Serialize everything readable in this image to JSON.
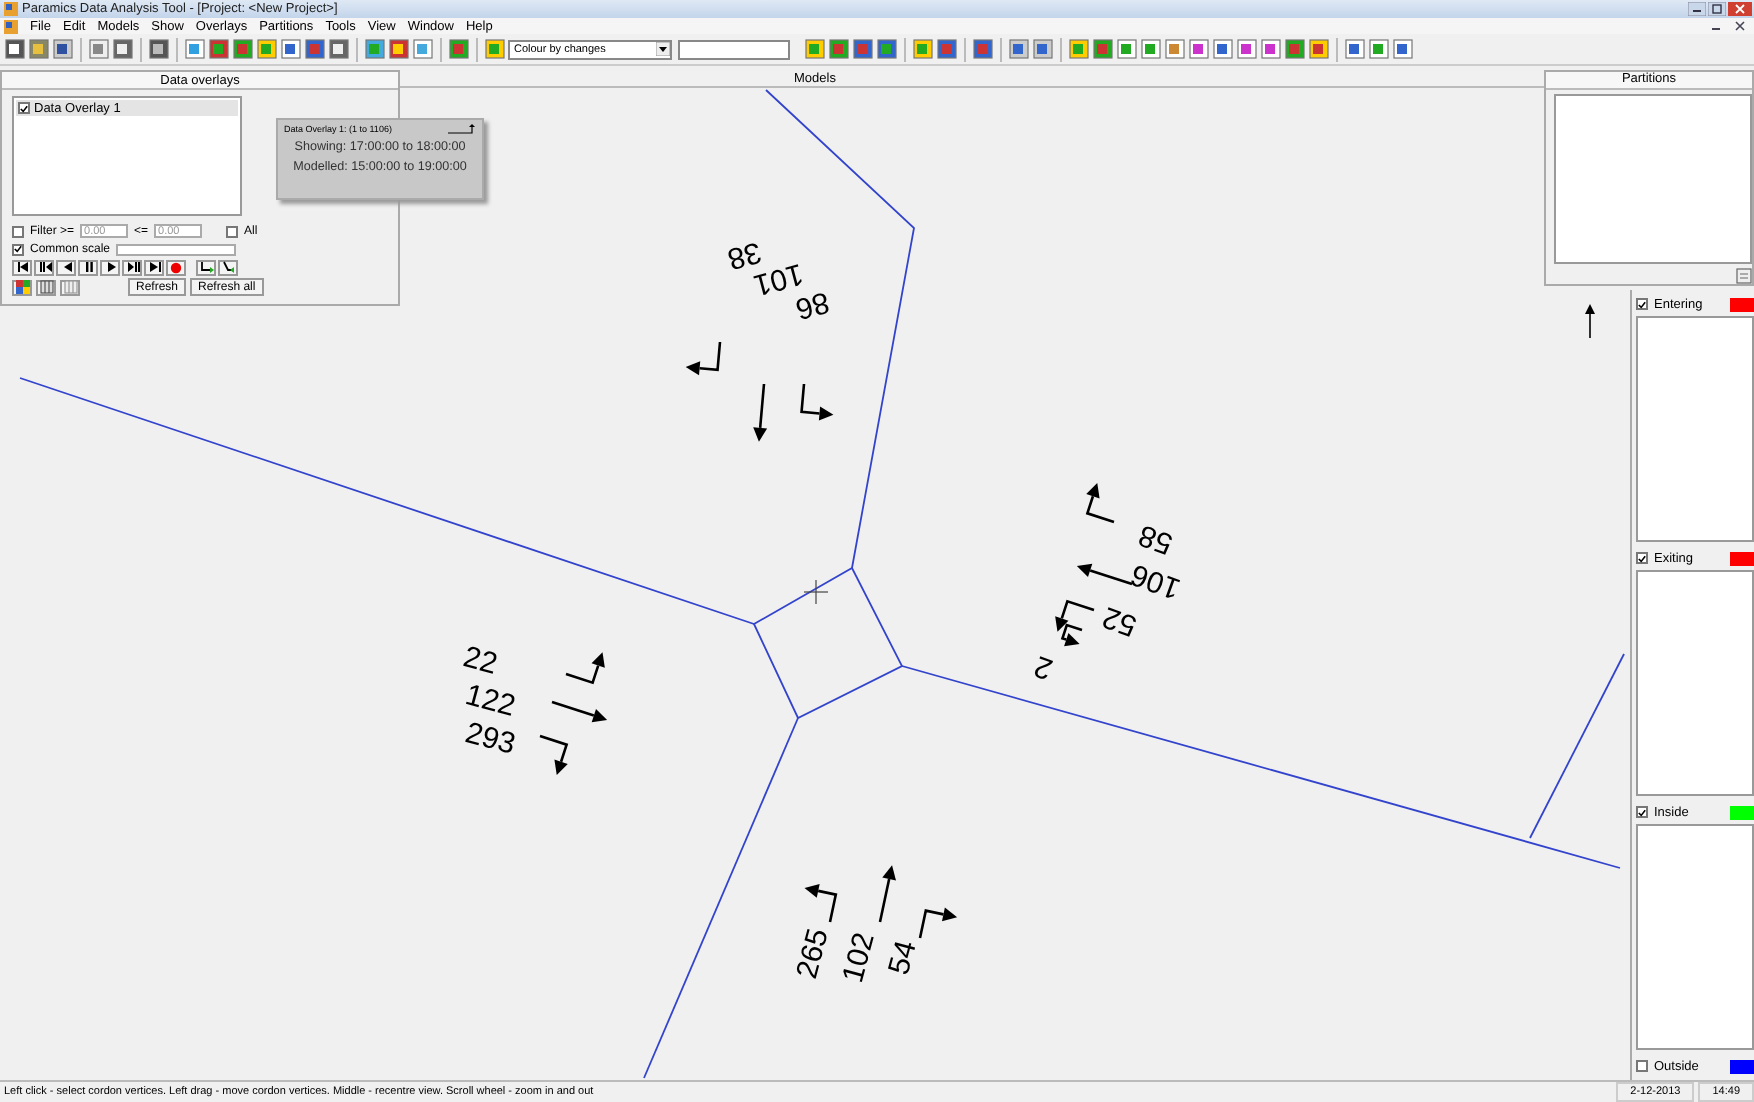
{
  "window": {
    "title": "Paramics Data Analysis Tool - [Project: <New Project>]"
  },
  "menu": [
    "File",
    "Edit",
    "Models",
    "Show",
    "Overlays",
    "Partitions",
    "Tools",
    "View",
    "Window",
    "Help"
  ],
  "toolbar": {
    "colour_mode": "Colour by changes"
  },
  "headers": {
    "data_overlays": "Data overlays",
    "models": "Models",
    "partitions": "Partitions"
  },
  "data_overlays": {
    "items": [
      {
        "label": "Data Overlay 1",
        "checked": true,
        "selected": true
      }
    ],
    "filter": {
      "label": "Filter >=",
      "checked": false,
      "min": "0.00",
      "between": "<=",
      "max": "0.00"
    },
    "all": {
      "label": "All",
      "checked": false
    },
    "common_scale": {
      "label": "Common scale",
      "checked": true
    },
    "buttons": [
      "Refresh",
      "Refresh all"
    ]
  },
  "overlay_info": {
    "title": "Data Overlay 1: (1 to 1106)",
    "showing": "Showing: 17:00:00 to 18:00:00",
    "modelled": "Modelled: 15:00:00 to 19:00:00"
  },
  "approaches": [
    {
      "movements": [
        {
          "kind": "right",
          "count": "38"
        },
        {
          "kind": "through",
          "count": "101"
        },
        {
          "kind": "left",
          "count": "86"
        }
      ]
    },
    {
      "movements": [
        {
          "kind": "right",
          "count": "58"
        },
        {
          "kind": "through",
          "count": "106"
        },
        {
          "kind": "left",
          "count": "52"
        },
        {
          "kind": "uturn",
          "count": "2"
        }
      ]
    },
    {
      "movements": [
        {
          "kind": "left",
          "count": "22"
        },
        {
          "kind": "through",
          "count": "122"
        },
        {
          "kind": "right",
          "count": "293"
        }
      ]
    },
    {
      "movements": [
        {
          "kind": "left",
          "count": "265"
        },
        {
          "kind": "through",
          "count": "102"
        },
        {
          "kind": "right",
          "count": "54"
        }
      ]
    }
  ],
  "legend": [
    {
      "label": "Entering",
      "checked": true,
      "color": "#ff0000"
    },
    {
      "label": "Exiting",
      "checked": true,
      "color": "#ff0000"
    },
    {
      "label": "Inside",
      "checked": true,
      "color": "#00ff00"
    },
    {
      "label": "Outside",
      "checked": false,
      "color": "#0000ff"
    }
  ],
  "status_bar": {
    "message": "Left click - select cordon vertices. Left drag - move cordon vertices. Middle - recentre view. Scroll wheel - zoom in and out",
    "date": "2-12-2013",
    "time": "14:49"
  }
}
